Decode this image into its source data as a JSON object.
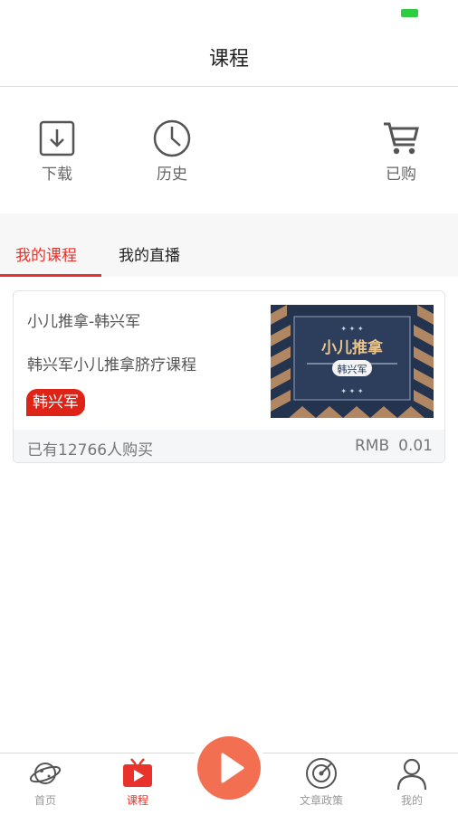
{
  "header": {
    "title": "课程"
  },
  "quick_actions": [
    {
      "label": "下载",
      "icon": "download-icon"
    },
    {
      "label": "历史",
      "icon": "history-clock-icon"
    },
    {
      "label": "已购",
      "icon": "cart-icon"
    }
  ],
  "tabs": [
    {
      "label": "我的课程",
      "active": true
    },
    {
      "label": "我的直播",
      "active": false
    }
  ],
  "course": {
    "title": "小儿推拿-韩兴军",
    "description": "韩兴军小儿推拿脐疗课程",
    "teacher": "韩兴军",
    "thumbnail_title": "小儿推拿",
    "thumbnail_subtitle": "韩兴军",
    "buyers": "已有12766人购买",
    "currency": "RMB",
    "price": "0.01"
  },
  "tabbar": {
    "items": [
      {
        "label": "首页",
        "icon": "planet-icon",
        "active": false
      },
      {
        "label": "课程",
        "icon": "tv-play-icon",
        "active": true
      },
      {
        "label": "",
        "icon": "play-icon",
        "active": false
      },
      {
        "label": "文章政策",
        "icon": "radar-icon",
        "active": false
      },
      {
        "label": "我的",
        "icon": "person-icon",
        "active": false
      }
    ]
  },
  "colors": {
    "accent": "#e8322b",
    "play_button": "#f26f52",
    "tag_bg": "#dd2417",
    "battery": "#2ecc40"
  }
}
